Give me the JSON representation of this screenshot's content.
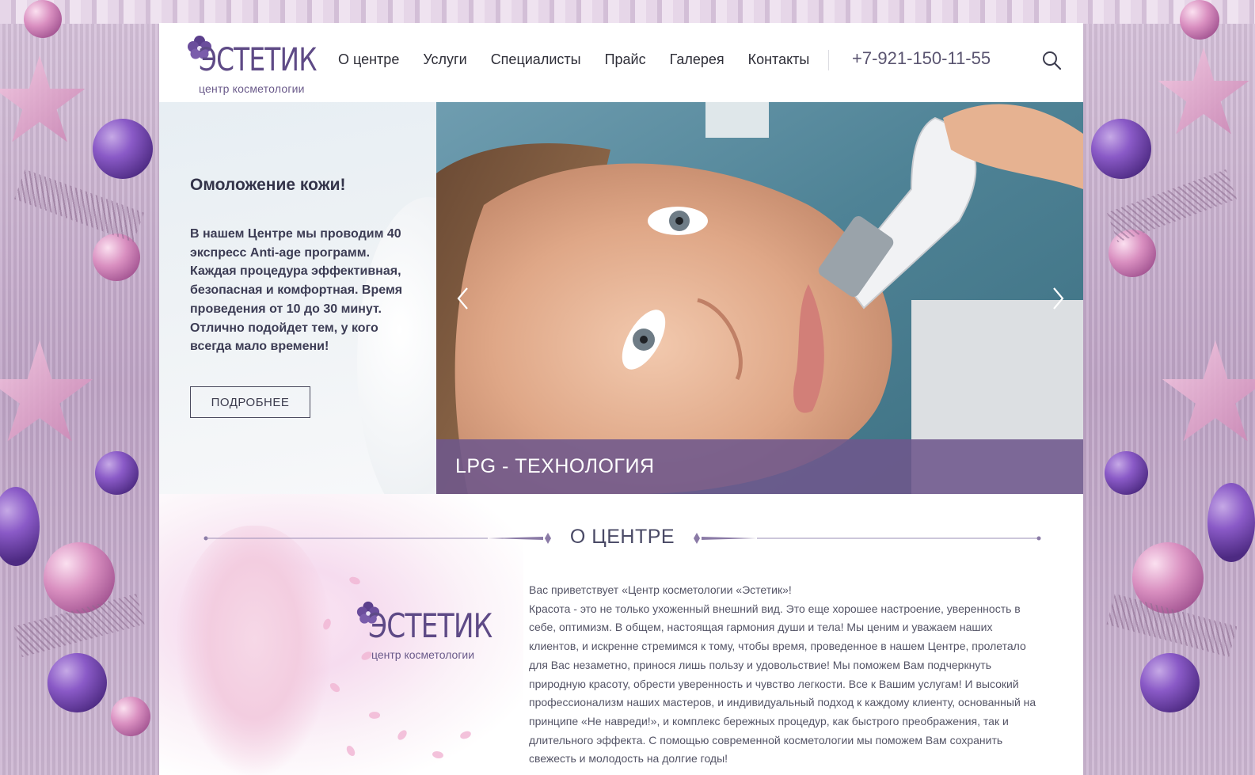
{
  "logo": {
    "name": "ЭСТЕТИК",
    "tagline": "центр косметологии"
  },
  "nav": {
    "items": [
      "О центре",
      "Услуги",
      "Специалисты",
      "Прайс",
      "Галерея",
      "Контакты"
    ]
  },
  "header": {
    "phone": "+7-921-150-11-55",
    "search_icon": "search-icon"
  },
  "hero": {
    "title": "Омоложение кожи!",
    "text": "В нашем Центре мы проводим 40 экспресс Anti-age программ. Каждая процедура эффективная, безопасная и комфортная. Время проведения от 10 до 30 минут. Отлично подойдет тем, у кого всегда мало времени!",
    "button_label": "ПОДРОБНЕЕ",
    "slide_caption": "LPG - ТЕХНОЛОГИЯ",
    "prev_icon": "chevron-left-icon",
    "next_icon": "chevron-right-icon"
  },
  "about": {
    "title": "О ЦЕНТРЕ",
    "logo_name": "ЭСТЕТИК",
    "logo_tagline": "центр косметологии",
    "greeting": "Вас приветствует «Центр косметологии «Эстетик»!",
    "body": "Красота - это не только ухоженный внешний вид. Это еще хорошее настроение, уверенность в себе, оптимизм. В общем, настоящая гармония души и тела! Мы ценим и уважаем наших клиентов, и искренне стремимся к тому, чтобы время, проведенное в нашем Центре, пролетало для Вас незаметно, принося лишь пользу и удовольствие! Мы поможем Вам подчеркнуть природную красоту, обрести уверенность и чувство легкости. Все к Вашим услугам! И высокий профессионализм наших мастеров, и индивидуальный подход к каждому клиенту, основанный на принципе «Не навреди!», и комплекс бережных процедур, как быстрого преображения, так и длительного эффекта. С помощью современной косметологии мы поможем Вам сохранить свежесть и молодость на долгие годы!"
  },
  "colors": {
    "brand": "#5e4a86",
    "caption_bar": "#6e588c",
    "text_dark": "#34344a"
  }
}
